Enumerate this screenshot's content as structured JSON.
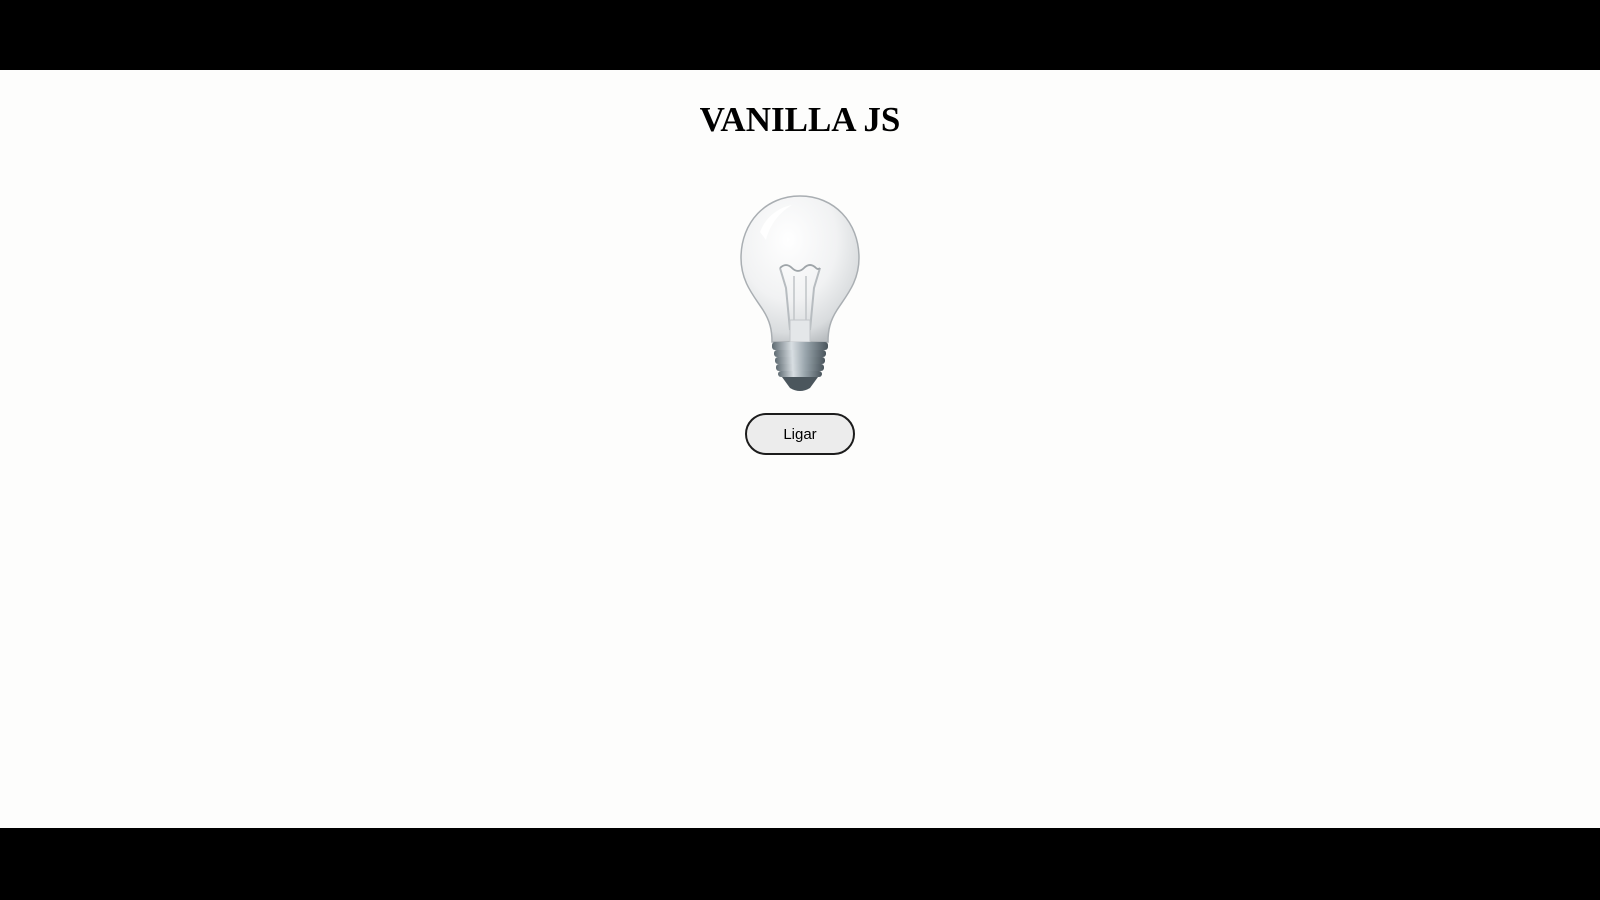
{
  "page": {
    "title": "VANILLA JS",
    "background": "#fdfdfc"
  },
  "lamp": {
    "icon": "light-bulb-icon",
    "state": "off"
  },
  "switch": {
    "label": "Ligar"
  }
}
